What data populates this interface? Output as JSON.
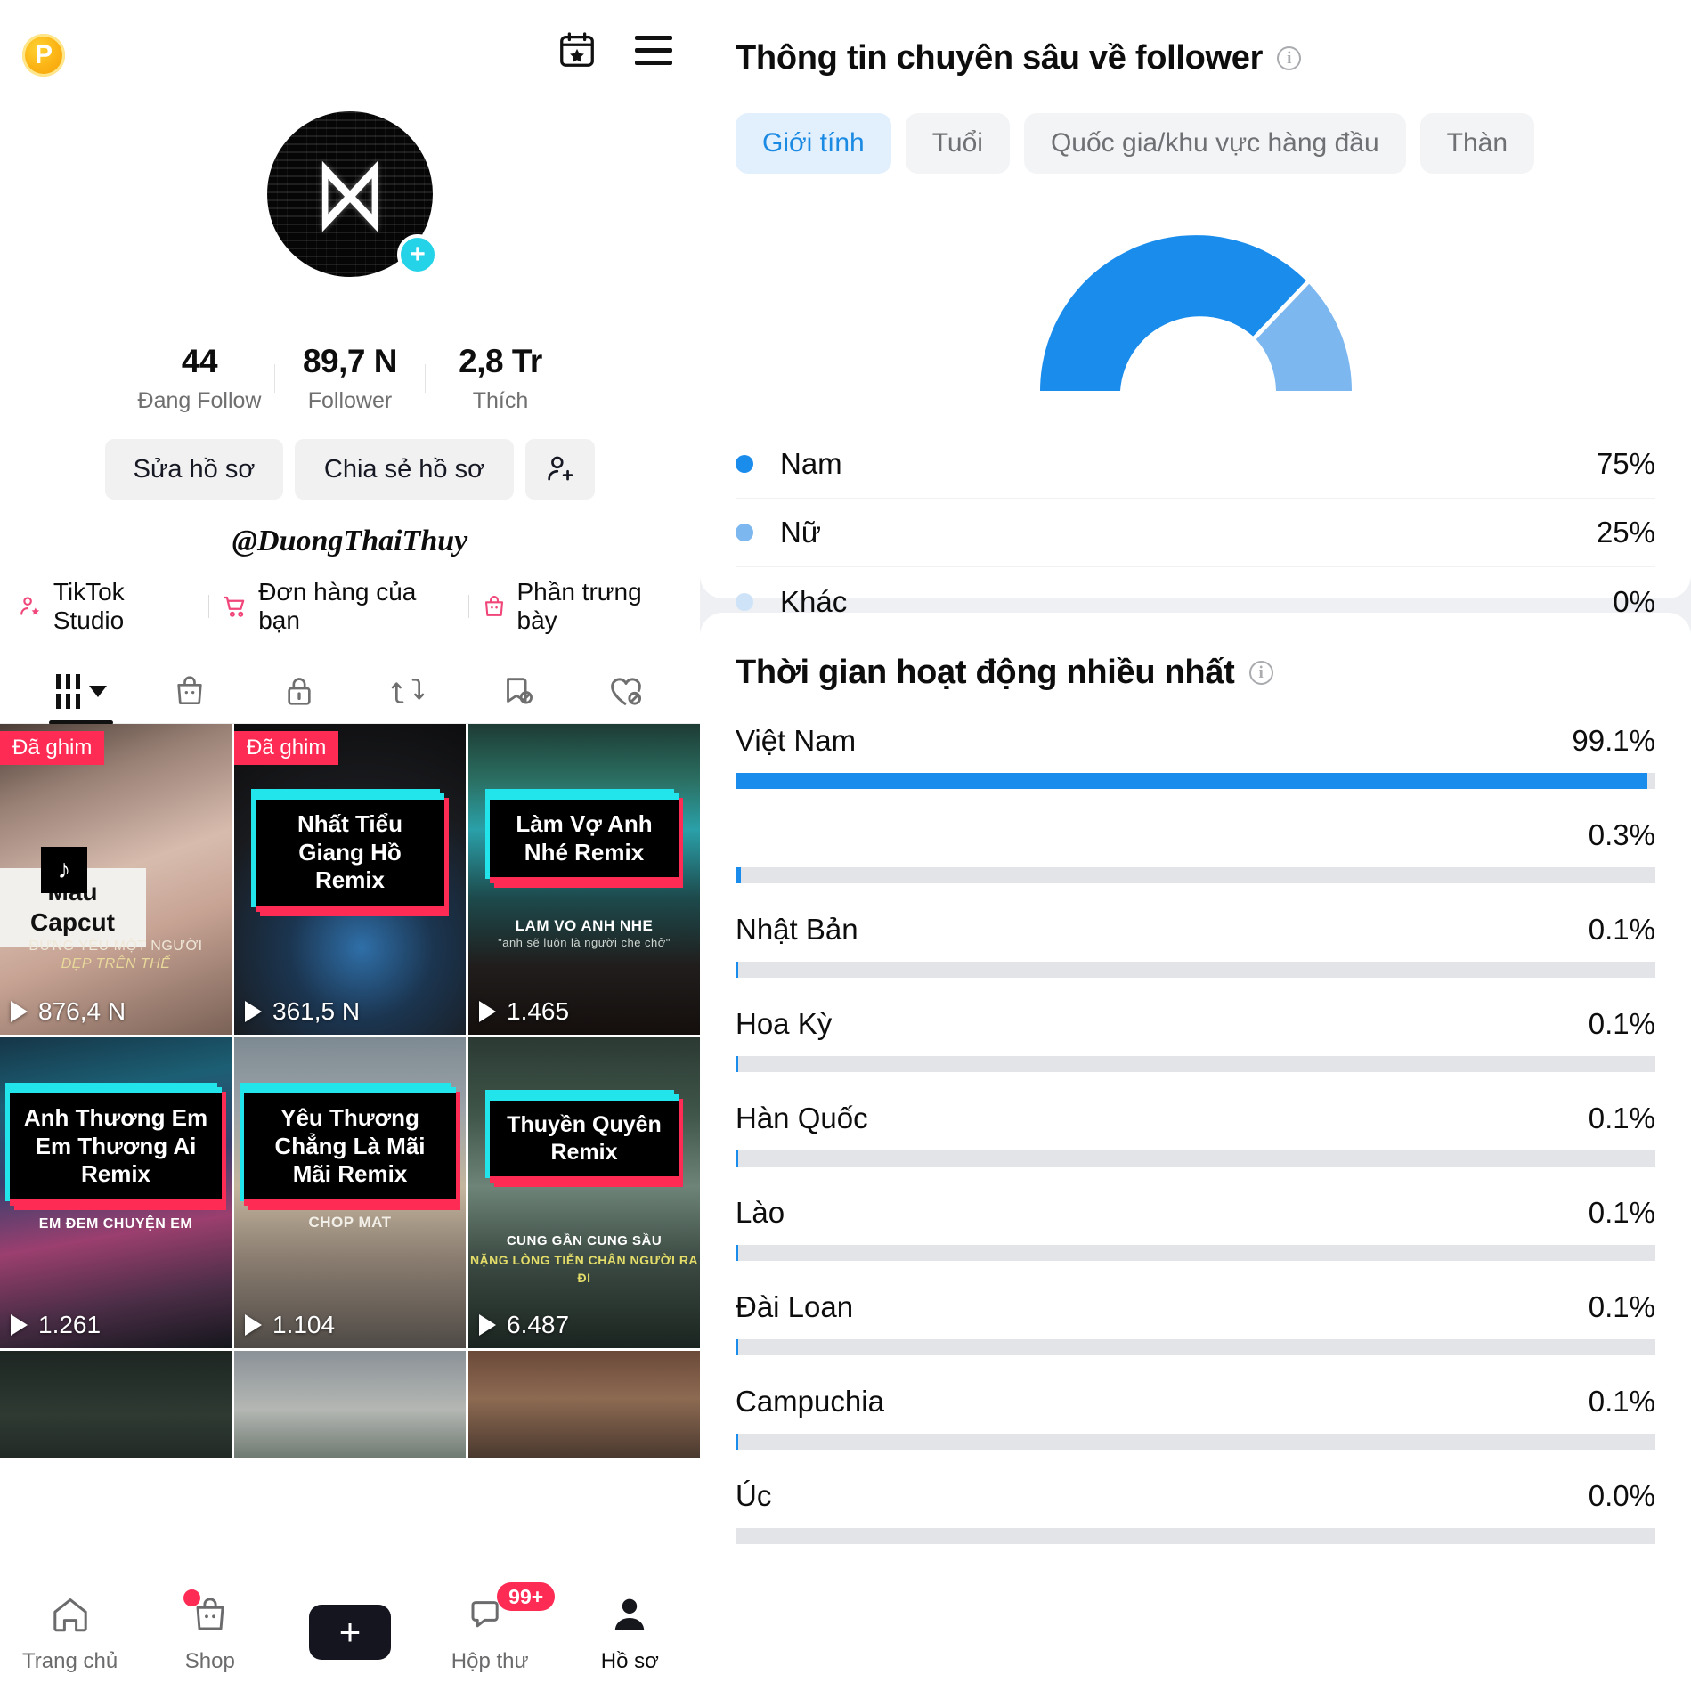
{
  "profile": {
    "coin_badge": "P",
    "calendar_icon": "calendar-star-icon",
    "menu_icon": "hamburger-menu-icon",
    "avatar_glyph": "capcut-logo-icon",
    "add_badge": "+",
    "stats": [
      {
        "value": "44",
        "label": "Đang Follow"
      },
      {
        "value": "89,7 N",
        "label": "Follower"
      },
      {
        "value": "2,8 Tr",
        "label": "Thích"
      }
    ],
    "buttons": {
      "edit": "Sửa hồ sơ",
      "share": "Chia sẻ hồ sơ",
      "add_friend_icon": "add-person-icon"
    },
    "handle": "@DuongThaiThuy",
    "links": [
      {
        "label": "TikTok Studio",
        "icon": "person-star-icon"
      },
      {
        "label": "Đơn hàng của bạn",
        "icon": "shopping-cart-icon"
      },
      {
        "label": "Phần trưng bày",
        "icon": "shopping-bag-lock-icon"
      }
    ],
    "tabs": [
      {
        "name": "grid-tab",
        "icon": "grid-bars-icon",
        "active": true
      },
      {
        "name": "shop-tab",
        "icon": "shopping-bag-icon",
        "active": false
      },
      {
        "name": "private-tab",
        "icon": "lock-icon",
        "active": false
      },
      {
        "name": "repost-tab",
        "icon": "repost-arrows-icon",
        "active": false
      },
      {
        "name": "saved-tab",
        "icon": "bookmark-hidden-icon",
        "active": false
      },
      {
        "name": "liked-tab",
        "icon": "heart-hidden-icon",
        "active": false
      }
    ],
    "videos": [
      {
        "pinned_label": "Đã ghim",
        "title": "Mẫu Capcut",
        "style": "white-plate",
        "sub1": "ĐỪNG YÊU MỘT NGƯỜI",
        "sub2": "ĐẸP TRÊN THẾ",
        "views": "876,4 N"
      },
      {
        "pinned_label": "Đã ghim",
        "title": "Nhất Tiểu Giang Hồ Remix",
        "style": "neon",
        "sub1": "",
        "sub2": "",
        "views": "361,5 N"
      },
      {
        "pinned_label": "",
        "title": "Làm Vợ Anh Nhé Remix",
        "style": "neon",
        "sub1": "LAM VO ANH NHE",
        "sub2": "\"anh sẽ luôn là người che chở\"",
        "views": "1.465"
      },
      {
        "pinned_label": "",
        "title": "Anh Thương Em Em Thương Ai Remix",
        "style": "neon",
        "sub1": "EM ĐEM CHUYỆN EM",
        "sub2": "",
        "views": "1.261"
      },
      {
        "pinned_label": "",
        "title": "Yêu Thương Chẳng Là Mãi Mãi Remix",
        "style": "neon",
        "sub1": "CHOP MAT",
        "sub2": "",
        "views": "1.104"
      },
      {
        "pinned_label": "",
        "title": "Thuyền Quyên Remix",
        "style": "neon",
        "sub1": "CUNG GẦN CUNG SẦU",
        "sub2": "NẶNG LÒNG TIỄN CHÂN NGƯỜI RA ĐI",
        "views": "6.487"
      }
    ],
    "bottom_nav": [
      {
        "label": "Trang chủ",
        "icon": "home-icon",
        "badge": "",
        "active": false
      },
      {
        "label": "Shop",
        "icon": "shopping-bag-icon",
        "badge": "dot",
        "active": false
      },
      {
        "label": "",
        "icon": "create-plus-icon",
        "badge": "",
        "active": false
      },
      {
        "label": "Hộp thư",
        "icon": "message-icon",
        "badge": "99+",
        "active": false
      },
      {
        "label": "Hồ sơ",
        "icon": "person-icon",
        "badge": "",
        "active": true
      }
    ]
  },
  "insights": {
    "title": "Thông tin chuyên sâu về follower",
    "info_icon": "info-circle-icon",
    "chips": [
      {
        "label": "Giới tính",
        "active": true
      },
      {
        "label": "Tuổi",
        "active": false
      },
      {
        "label": "Quốc gia/khu vực hàng đầu",
        "active": false
      },
      {
        "label": "Thàn",
        "active": false
      }
    ]
  },
  "activity": {
    "title": "Thời gian hoạt động nhiều nhất",
    "info_icon": "info-circle-icon"
  },
  "colors": {
    "accent_blue": "#1a8cec",
    "light_blue": "#7db7ef",
    "pale_blue": "#cfe3f8",
    "tiktok_pink": "#fe2c55",
    "tiktok_cyan": "#22e4eb",
    "track_grey": "#e2e4e8",
    "chip_active_bg": "#e2effd",
    "chip_active_fg": "#1b8ae3"
  },
  "chart_data": [
    {
      "type": "pie",
      "title": "Thông tin chuyên sâu về follower",
      "subtitle": "Giới tính",
      "variant": "half-donut-gauge",
      "legend_position": "below",
      "categories": [
        "Nam",
        "Nữ",
        "Khác"
      ],
      "values": [
        75,
        25,
        0
      ],
      "value_labels": [
        "75%",
        "25%",
        "0%"
      ],
      "colors": [
        "#1a8cec",
        "#7db7ef",
        "#cfe3f8"
      ],
      "unit": "%"
    },
    {
      "type": "bar",
      "orientation": "horizontal",
      "title": "Thời gian hoạt động nhiều nhất",
      "xlabel": "",
      "ylabel": "",
      "xlim": [
        0,
        100
      ],
      "grid": false,
      "legend_position": "none",
      "bar_color": "#1a8cec",
      "track_color": "#e2e4e8",
      "categories": [
        "Việt Nam",
        "",
        "Nhật Bản",
        "Hoa Kỳ",
        "Hàn Quốc",
        "Lào",
        "Đài Loan",
        "Campuchia",
        "Úc"
      ],
      "values": [
        99.1,
        0.3,
        0.1,
        0.1,
        0.1,
        0.1,
        0.1,
        0.1,
        0.0
      ],
      "value_labels": [
        "99.1%",
        "0.3%",
        "0.1%",
        "0.1%",
        "0.1%",
        "0.1%",
        "0.1%",
        "0.1%",
        "0.0%"
      ]
    }
  ]
}
